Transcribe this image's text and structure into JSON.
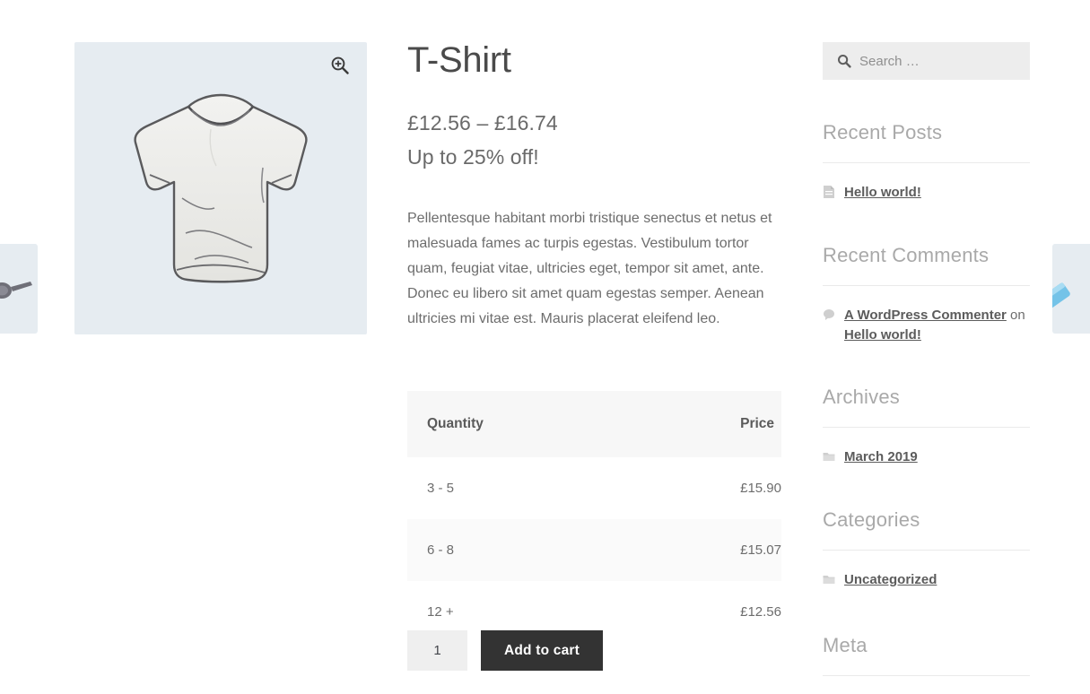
{
  "product": {
    "title": "T-Shirt",
    "price_range": "£12.56 – £16.74",
    "price_note": "Up to 25% off!",
    "description": "Pellentesque habitant morbi tristique senectus et netus et malesuada fames ac turpis egestas. Vestibulum tortor quam, feugiat vitae, ultricies eget, tempor sit amet, ante. Donec eu libero sit amet quam egestas semper. Aenean ultricies mi vitae est. Mauris placerat eleifend leo.",
    "gallery": {
      "image_alt": "t-shirt",
      "zoom_icon": "zoom-in-icon",
      "background": "#e6ecf1"
    }
  },
  "tier_table": {
    "headers": [
      "Quantity",
      "Price"
    ],
    "rows": [
      {
        "quantity": "3 - 5",
        "price": "£15.90"
      },
      {
        "quantity": "6 - 8",
        "price": "£15.07"
      },
      {
        "quantity": "12 +",
        "price": "£12.56"
      }
    ]
  },
  "cart": {
    "quantity_value": "1",
    "quantity_placeholder": "1",
    "add_to_cart_label": "Add to cart",
    "button_color": "#333333"
  },
  "sidebar": {
    "search": {
      "placeholder": "Search …",
      "value": "",
      "icon": "search-icon"
    },
    "widgets": [
      {
        "title": "Recent Posts",
        "items": [
          {
            "icon": "post-icon",
            "link": "Hello world!"
          }
        ]
      },
      {
        "title": "Recent Comments",
        "items": [
          {
            "icon": "comment-icon",
            "author": "A WordPress Commenter",
            "connector": " on ",
            "link": "Hello world!"
          }
        ]
      },
      {
        "title": "Archives",
        "items": [
          {
            "icon": "folder-icon",
            "link": "March 2019"
          }
        ]
      },
      {
        "title": "Categories",
        "items": [
          {
            "icon": "folder-icon",
            "link": "Uncategorized"
          }
        ]
      },
      {
        "title": "Meta",
        "items": []
      }
    ]
  }
}
